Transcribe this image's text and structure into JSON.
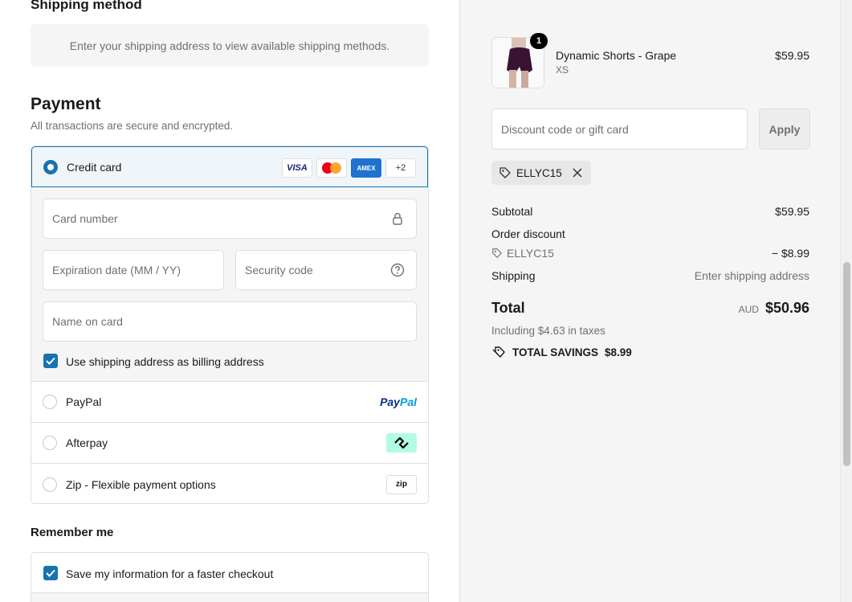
{
  "shipping_method": {
    "heading": "Shipping method",
    "message": "Enter your shipping address to view available shipping methods."
  },
  "payment": {
    "heading": "Payment",
    "subtitle": "All transactions are secure and encrypted.",
    "credit_card": {
      "label": "Credit card",
      "brands": [
        "VISA",
        "mastercard",
        "AMEX",
        "+2"
      ],
      "card_number_placeholder": "Card number",
      "expiry_placeholder": "Expiration date (MM / YY)",
      "security_code_placeholder": "Security code",
      "name_placeholder": "Name on card",
      "billing_checkbox_label": "Use shipping address as billing address",
      "billing_checked": true
    },
    "options": [
      {
        "label": "PayPal",
        "logo": "paypal-logo"
      },
      {
        "label": "Afterpay",
        "logo": "afterpay-logo"
      },
      {
        "label": "Zip - Flexible payment options",
        "logo": "zip-logo"
      }
    ],
    "paypal_logo_text": [
      "Pay",
      "Pal"
    ],
    "zip_logo_text": "zip"
  },
  "remember_me": {
    "heading": "Remember me",
    "save_label": "Save my information for a faster checkout",
    "save_checked": true
  },
  "summary": {
    "product": {
      "name": "Dynamic Shorts - Grape",
      "variant": "XS",
      "price": "$59.95",
      "quantity": "1"
    },
    "discount_placeholder": "Discount code or gift card",
    "apply_label": "Apply",
    "applied_code": "ELLYC15",
    "subtotal_label": "Subtotal",
    "subtotal_value": "$59.95",
    "order_discount_label": "Order discount",
    "discount_code": "ELLYC15",
    "discount_value": "− $8.99",
    "shipping_label": "Shipping",
    "shipping_value": "Enter shipping address",
    "total_label": "Total",
    "currency": "AUD",
    "total_value": "$50.96",
    "taxes_note": "Including $4.63 in taxes",
    "savings_label": "TOTAL SAVINGS",
    "savings_value": "$8.99"
  },
  "colors": {
    "accent": "#1773b0",
    "summary_bg": "#f5f5f5"
  }
}
